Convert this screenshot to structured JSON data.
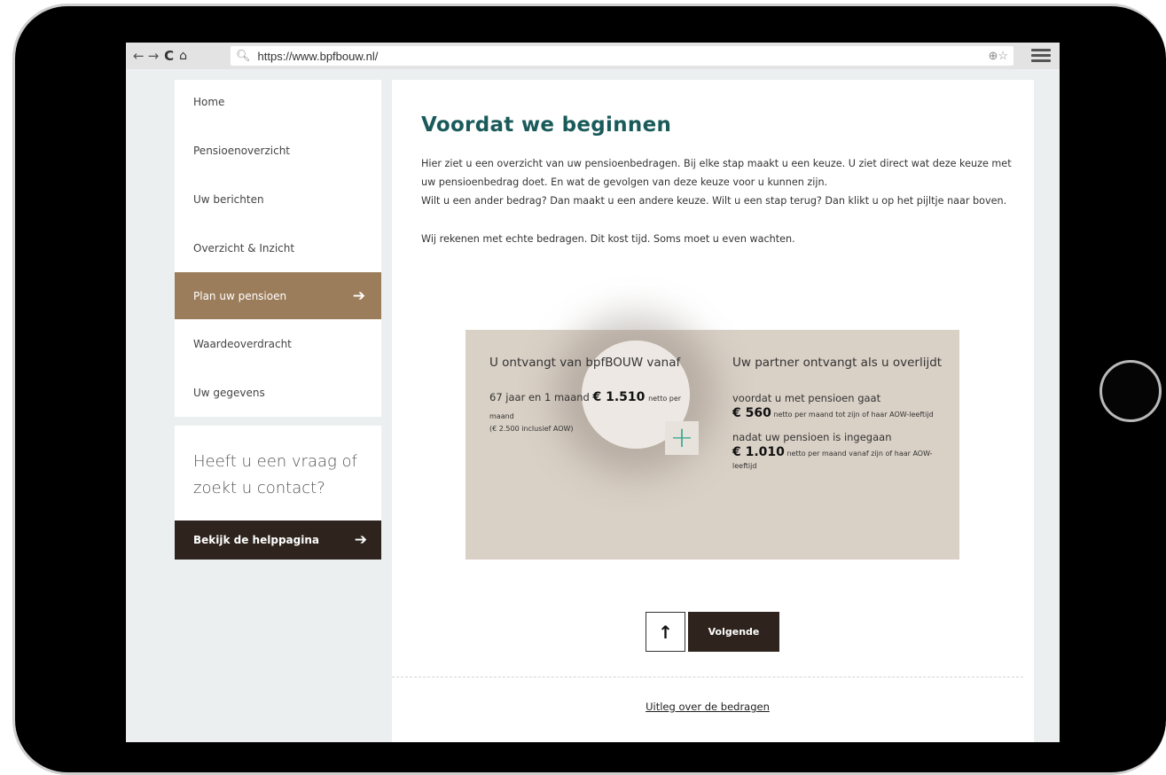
{
  "browser": {
    "url": "https://www.bpfbouw.nl/",
    "back_icon": "←",
    "forward_icon": "→",
    "reload_icon": "C",
    "home_icon": "⌂"
  },
  "sidebar": {
    "items": [
      {
        "label": "Home"
      },
      {
        "label": "Pensioenoverzicht"
      },
      {
        "label": "Uw berichten"
      },
      {
        "label": "Overzicht & Inzicht"
      },
      {
        "label": "Plan uw pensioen"
      },
      {
        "label": "Waardeoverdracht"
      },
      {
        "label": "Uw gegevens"
      }
    ],
    "help_text": "Heeft u een vraag of zoekt u contact?",
    "help_button": "Bekijk de helppagina"
  },
  "main": {
    "title": "Voordat we beginnen",
    "intro_1": "Hier ziet u een overzicht van uw pensioenbedragen. Bij elke stap maakt u een keuze. U ziet direct wat deze keuze met uw pensioenbedrag doet. En wat de gevolgen van deze keuze voor u kunnen zijn.",
    "intro_2": "Wilt u een ander bedrag? Dan maakt u een andere keuze. Wilt u een stap terug? Dan klikt u op het pijltje naar boven.",
    "intro_3": "Wij rekenen met echte bedragen. Dit kost tijd. Soms moet u even wachten.",
    "left_col": {
      "heading": "U ontvangt van bpfBOUW vanaf",
      "age": "67 jaar en 1 maand",
      "amount": "€ 1.510",
      "unit": "netto per maand",
      "note": "(€ 2.500 inclusief AOW)"
    },
    "right_col": {
      "heading": "Uw partner ontvangt als u overlijdt",
      "before_label": "voordat u met pensioen gaat",
      "before_amount": "€ 560",
      "before_unit": "netto per maand tot zijn of haar AOW-leeftijd",
      "after_label": "nadat uw pensioen is ingegaan",
      "after_amount": "€ 1.010",
      "after_unit": "netto per maand vanaf zijn of haar AOW-leeftijd"
    },
    "next_button": "Volgende",
    "explain_link": "Uitleg over de bedragen"
  },
  "colors": {
    "accent": "#9c7d5b",
    "dark": "#2e241d",
    "title": "#1a5a5a",
    "plus": "#2ba58a"
  }
}
